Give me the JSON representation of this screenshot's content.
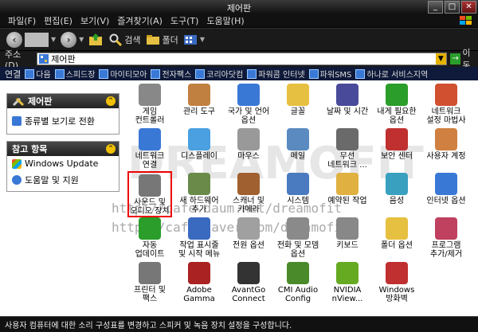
{
  "window": {
    "title": "제어판",
    "min": "_",
    "max": "□",
    "close": "✕"
  },
  "menu": [
    "파일(F)",
    "편집(E)",
    "보기(V)",
    "즐겨찾기(A)",
    "도구(T)",
    "도움말(H)"
  ],
  "toolbar": {
    "back_label": "",
    "search_label": "검색",
    "folders_label": "폴더"
  },
  "address": {
    "label": "주소(D)",
    "value": "제어판",
    "go_label": "이동"
  },
  "links": {
    "label": "연결",
    "items": [
      "다음",
      "스피드장",
      "마이티모아",
      "전자팩스",
      "코리아닷컴",
      "파워콤 인터넷",
      "파워SMS",
      "하나로 서비스지역"
    ]
  },
  "sidebar": {
    "control_panel_title": "제어판",
    "switch_view_label": "종류별 보기로 전환",
    "see_also_title": "참고 항목",
    "see_also_items": [
      "Windows Update",
      "도움말 및 지원"
    ]
  },
  "icons": [
    {
      "label": "게임\n컨트롤러",
      "color": "#888888"
    },
    {
      "label": "관리 도구",
      "color": "#c08040"
    },
    {
      "label": "국가 및 언어\n옵션",
      "color": "#3a78d6"
    },
    {
      "label": "글꼴",
      "color": "#e6c040"
    },
    {
      "label": "날짜 및 시간",
      "color": "#4a4a9a"
    },
    {
      "label": "내게 필요한\n옵션",
      "color": "#2a9d2a"
    },
    {
      "label": "네트워크\n설정 마법사",
      "color": "#d05030"
    },
    {
      "label": "네트워크\n연결",
      "color": "#3a78d6"
    },
    {
      "label": "디스플레이",
      "color": "#4aa0e0"
    },
    {
      "label": "마우스",
      "color": "#999999"
    },
    {
      "label": "메일",
      "color": "#5a8ac0"
    },
    {
      "label": "무선\n네트워크 ...",
      "color": "#6a6a6a"
    },
    {
      "label": "보안 센터",
      "color": "#c03030"
    },
    {
      "label": "사용자 계정",
      "color": "#d08040"
    },
    {
      "label": "사운드 및\n오디오 장치",
      "color": "#777777"
    },
    {
      "label": "새 하드웨어\n추가",
      "color": "#6a8a4a"
    },
    {
      "label": "스캐너 및\n카메라",
      "color": "#a06030"
    },
    {
      "label": "시스템",
      "color": "#4a7ac0"
    },
    {
      "label": "예약된 작업",
      "color": "#e0b040"
    },
    {
      "label": "음성",
      "color": "#3aa0c0"
    },
    {
      "label": "인터넷 옵션",
      "color": "#3a78d6"
    },
    {
      "label": "자동\n업데이트",
      "color": "#2a9d2a"
    },
    {
      "label": "작업 표시줄\n및 시작 메뉴",
      "color": "#3a6ac0"
    },
    {
      "label": "전원 옵션",
      "color": "#a0a0a0"
    },
    {
      "label": "전화 및 모뎀\n옵션",
      "color": "#8a8a8a"
    },
    {
      "label": "키보드",
      "color": "#888888"
    },
    {
      "label": "폴더 옵션",
      "color": "#e6c040"
    },
    {
      "label": "프로그램\n추가/제거",
      "color": "#c04060"
    },
    {
      "label": "프린터 및\n팩스",
      "color": "#777777"
    },
    {
      "label": "Adobe\nGamma",
      "color": "#aa2222"
    },
    {
      "label": "AvantGo\nConnect",
      "color": "#333333"
    },
    {
      "label": "CMI Audio\nConfig",
      "color": "#4a8a2a"
    },
    {
      "label": "NVIDIA\nnView...",
      "color": "#66aa22"
    },
    {
      "label": "Windows\n방화벽",
      "color": "#c03030"
    }
  ],
  "watermark": {
    "logo": "DREAMOFIT",
    "url1": "http://cafe.daum.net/dreamofit",
    "url2": "http://cafe.naver.com/dreamofit"
  },
  "status": "사용자 컴퓨터에 대한 소리 구성표를 변경하고 스피커 및 녹음 장치 설정을 구성합니다."
}
